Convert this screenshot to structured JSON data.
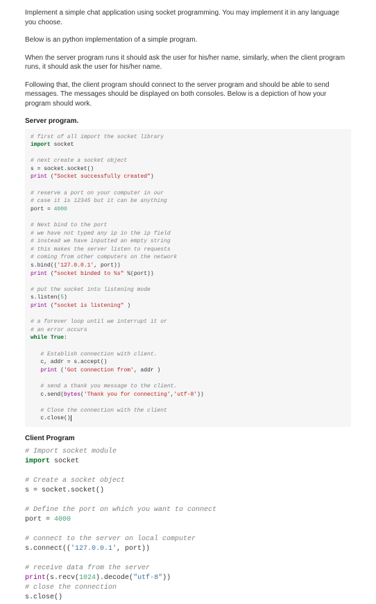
{
  "paras": {
    "p1": "Implement a simple chat application using socket programming. You may implement it in any language you choose.",
    "p2": "Below is an python implementation of a simple program.",
    "p3": "When the server program runs it should ask the user for his/her name, similarly, when the client program runs, it should ask the user for his/her name.",
    "p4": "Following that, the client program should connect to the server program and should be able to send messages. The messages should be displayed on both consoles. Below is a depiction of how your program should work."
  },
  "headings": {
    "server": "Server program.",
    "client": "Client Program"
  },
  "colors": {
    "comment": "#808080",
    "keyword": "#007020",
    "string": "#BA2121",
    "string2": "#4070a0",
    "name": "#333",
    "builtin": "#900090",
    "number": "#40a070"
  },
  "server_lines": [
    [
      [
        "# first of all import the socket library",
        "comment"
      ]
    ],
    [
      [
        "import ",
        "keyword"
      ],
      [
        "socket",
        "name"
      ]
    ],
    [],
    [
      [
        "# next create a socket object",
        "comment"
      ]
    ],
    [
      [
        "s = socket.socket()",
        "name"
      ]
    ],
    [
      [
        "print",
        "builtin"
      ],
      [
        " (",
        "name"
      ],
      [
        "\"Socket successfully created\"",
        "string"
      ],
      [
        ")",
        "name"
      ]
    ],
    [],
    [
      [
        "# reserve a port on your computer in our",
        "comment"
      ]
    ],
    [
      [
        "# case it is 12345 but it can be anything",
        "comment"
      ]
    ],
    [
      [
        "port = ",
        "name"
      ],
      [
        "4000",
        "number"
      ]
    ],
    [],
    [
      [
        "# Next bind to the port",
        "comment"
      ]
    ],
    [
      [
        "# we have not typed any ip in the ip field",
        "comment"
      ]
    ],
    [
      [
        "# instead we have inputted an empty string",
        "comment"
      ]
    ],
    [
      [
        "# this makes the server listen to requests",
        "comment"
      ]
    ],
    [
      [
        "# coming from other computers on the network",
        "comment"
      ]
    ],
    [
      [
        "s.bind((",
        "name"
      ],
      [
        "'127.0.0.1'",
        "string"
      ],
      [
        ", port))",
        "name"
      ]
    ],
    [
      [
        "print",
        "builtin"
      ],
      [
        " (",
        "name"
      ],
      [
        "\"socket binded to %s\"",
        "string"
      ],
      [
        " %(port))",
        "name"
      ]
    ],
    [],
    [
      [
        "# put the socket into listening mode",
        "comment"
      ]
    ],
    [
      [
        "s.listen(",
        "name"
      ],
      [
        "5",
        "number"
      ],
      [
        ")",
        "name"
      ]
    ],
    [
      [
        "print",
        "builtin"
      ],
      [
        " (",
        "name"
      ],
      [
        "\"socket is listening\"",
        "string"
      ],
      [
        " )",
        "name"
      ]
    ],
    [],
    [
      [
        "# a forever loop until we interrupt it or",
        "comment"
      ]
    ],
    [
      [
        "# an error occurs",
        "comment"
      ]
    ],
    [
      [
        "while ",
        "keyword"
      ],
      [
        "True",
        "keyword"
      ],
      [
        ":",
        "name"
      ]
    ],
    [],
    [
      [
        "   # Establish connection with client.",
        "comment"
      ]
    ],
    [
      [
        "   c, addr = s.accept()",
        "name"
      ]
    ],
    [
      [
        "   ",
        "name"
      ],
      [
        "print",
        "builtin"
      ],
      [
        " (",
        "name"
      ],
      [
        "'Got connection from'",
        "string"
      ],
      [
        ", addr )",
        "name"
      ]
    ],
    [],
    [
      [
        "   # send a thank you message to the client.",
        "comment"
      ]
    ],
    [
      [
        "   c.send(",
        "name"
      ],
      [
        "bytes",
        "builtin"
      ],
      [
        "(",
        "name"
      ],
      [
        "'Thank you for connecting'",
        "string"
      ],
      [
        ",",
        "name"
      ],
      [
        "'utf-8'",
        "string"
      ],
      [
        "))",
        "name"
      ]
    ],
    [],
    [
      [
        "   # Close the connection with the client",
        "comment"
      ]
    ],
    [
      [
        "   c.close()",
        "name"
      ]
    ]
  ],
  "client_lines": [
    [
      [
        "# Import socket module",
        "comment"
      ]
    ],
    [
      [
        "import ",
        "keyword"
      ],
      [
        "socket",
        "name"
      ]
    ],
    [],
    [
      [
        "# Create a socket object",
        "comment"
      ]
    ],
    [
      [
        "s = socket.socket()",
        "name"
      ]
    ],
    [],
    [
      [
        "# Define the port on which you want to connect",
        "comment"
      ]
    ],
    [
      [
        "port = ",
        "name"
      ],
      [
        "4000",
        "number"
      ]
    ],
    [],
    [
      [
        "# connect to the server on local computer",
        "comment"
      ]
    ],
    [
      [
        "s.connect((",
        "name"
      ],
      [
        "'127.0.0.1'",
        "string2"
      ],
      [
        ", port))",
        "name"
      ]
    ],
    [],
    [
      [
        "# receive data from the server",
        "comment"
      ]
    ],
    [
      [
        "print",
        "builtin"
      ],
      [
        "(s.recv(",
        "name"
      ],
      [
        "1024",
        "number"
      ],
      [
        ").decode(",
        "name"
      ],
      [
        "\"utf-8\"",
        "string2"
      ],
      [
        "))",
        "name"
      ]
    ],
    [
      [
        "# close the connection",
        "comment"
      ]
    ],
    [
      [
        "s.close()",
        "name"
      ]
    ]
  ]
}
